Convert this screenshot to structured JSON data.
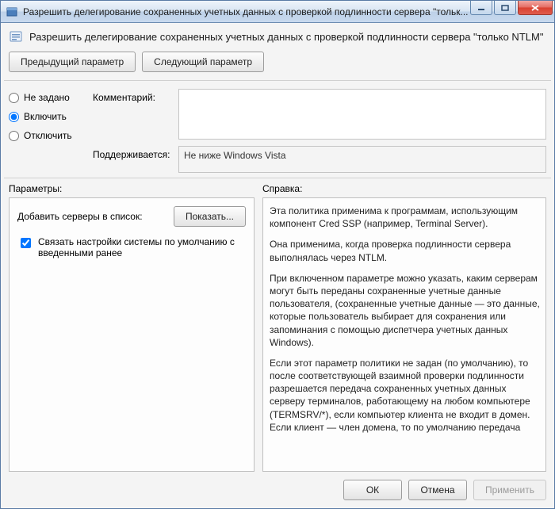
{
  "window": {
    "title": "Разрешить делегирование сохраненных учетных данных с проверкой подлинности сервера \"тольк..."
  },
  "header": {
    "title": "Разрешить делегирование сохраненных учетных данных с проверкой подлинности сервера \"только NTLM\""
  },
  "nav": {
    "prev": "Предыдущий параметр",
    "next": "Следующий параметр"
  },
  "state": {
    "not_configured": "Не задано",
    "enabled": "Включить",
    "disabled": "Отключить",
    "selected": "enabled"
  },
  "fields": {
    "comment_label": "Комментарий:",
    "comment_value": "",
    "supported_label": "Поддерживается:",
    "supported_value": "Не ниже Windows Vista"
  },
  "split": {
    "params_label": "Параметры:",
    "help_label": "Справка:"
  },
  "params": {
    "add_servers_label": "Добавить серверы в список:",
    "show_button": "Показать...",
    "concat_checkbox_label": "Связать настройки системы по умолчанию с введенными ранее",
    "concat_checked": true
  },
  "help": {
    "p1": "Эта политика применима к программам, использующим компонент Cred SSP (например, Terminal Server).",
    "p2": "Она применима, когда проверка подлинности сервера выполнялась через NTLM.",
    "p3": "При включенном параметре можно указать, каким серверам могут быть переданы сохраненные учетные данные пользователя, (сохраненные учетные данные — это данные, которые пользователь выбирает для сохранения или запоминания с помощью диспетчера учетных данных Windows).",
    "p4": "Если этот параметр политики не задан (по умолчанию), то после соответствующей взаимной проверки подлинности разрешается передача сохраненных учетных данных серверу терминалов, работающему на любом компьютере (TERMSRV/*), если компьютер клиента не входит в домен. Если клиент — член домена, то по умолчанию передача"
  },
  "footer": {
    "ok": "ОК",
    "cancel": "Отмена",
    "apply": "Применить"
  }
}
